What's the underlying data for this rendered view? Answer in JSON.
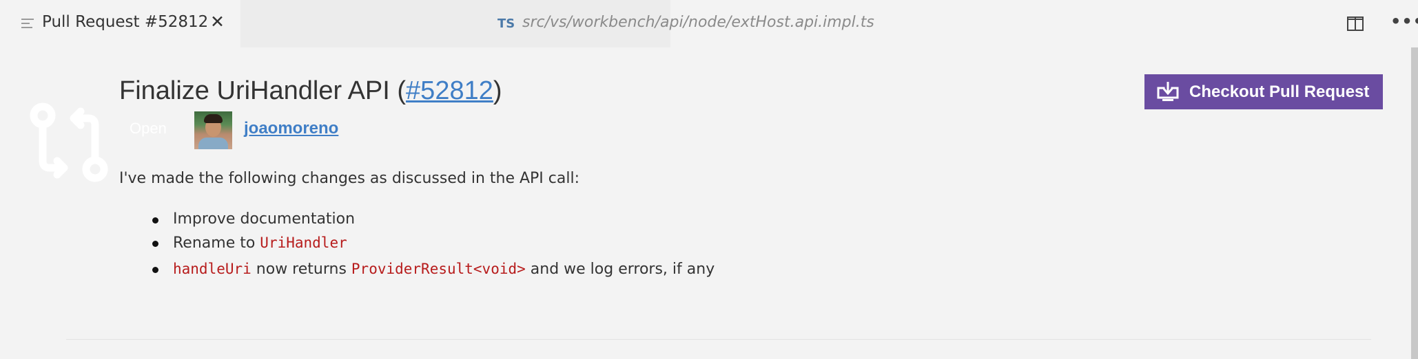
{
  "tabs": {
    "active_title": "Pull Request #52812",
    "close_glyph": "✕",
    "inactive_badge": "TS",
    "inactive_path": "src/vs/workbench/api/node/extHost.api.impl.ts"
  },
  "editor_actions": {
    "more_glyph": "•••"
  },
  "pull_request": {
    "title_prefix": "Finalize UriHandler API (",
    "number_link": "#52812",
    "title_suffix": ")",
    "status": "Open",
    "author": "joaomoreno",
    "checkout_label": "Checkout Pull Request",
    "description": "I've made the following changes as discussed in the API call:",
    "bullets": {
      "b1_text": "Improve documentation",
      "b2_text": "Rename to ",
      "b2_code": "UriHandler",
      "b3_code1": "handleUri",
      "b3_mid": " now returns ",
      "b3_code2": "ProviderResult<void>",
      "b3_tail": " and we log errors, if any"
    }
  },
  "colors": {
    "accent_button": "#6a4ca1",
    "link": "#3f7ec6",
    "code": "#b71c1c",
    "background": "#f3f3f3"
  },
  "icons": {
    "tab_file": "file-lines-icon",
    "split_editor": "split-editor-icon",
    "more": "ellipsis-icon",
    "pull_request": "git-pull-request-icon",
    "checkout": "download-icon"
  }
}
